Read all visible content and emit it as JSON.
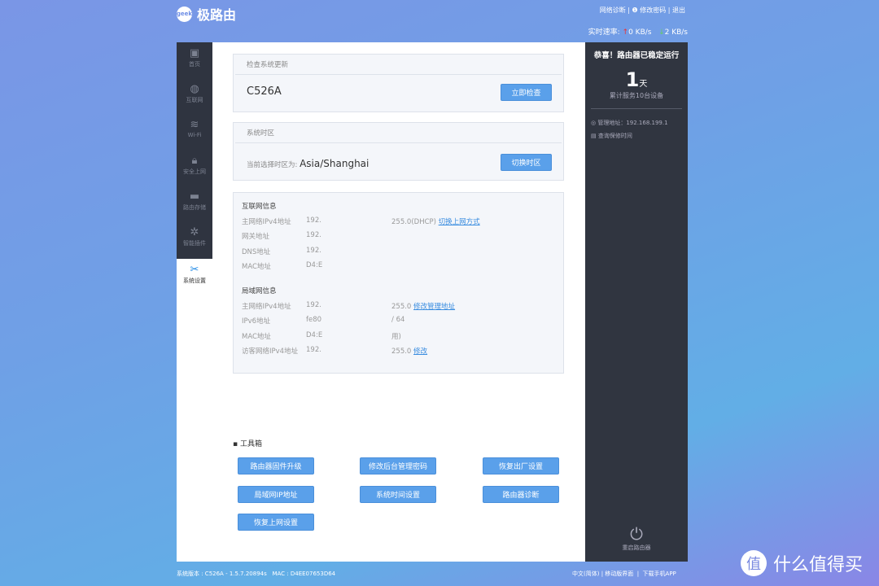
{
  "header": {
    "brand": "极路由",
    "logo_text": "geek",
    "links": [
      "网络诊断",
      "修改密码",
      "退出"
    ],
    "speed_label": "实时速率:",
    "upload": "0 KB/s",
    "download": "2 KB/s"
  },
  "sidebar": {
    "items": [
      {
        "label": "首页",
        "icon": "monitor-icon"
      },
      {
        "label": "互联网",
        "icon": "globe-icon"
      },
      {
        "label": "Wi-Fi",
        "icon": "wifi-icon"
      },
      {
        "label": "安全上网",
        "icon": "lock-icon"
      },
      {
        "label": "路由存储",
        "icon": "folder-icon"
      },
      {
        "label": "智能插件",
        "icon": "plugin-icon"
      },
      {
        "label": "系统设置",
        "icon": "wrench-icon",
        "active": true
      }
    ]
  },
  "update": {
    "title": "检查系统更新",
    "model": "C526A",
    "button": "立即检查"
  },
  "timezone": {
    "title": "系统时区",
    "label": "当前选择时区为:",
    "value": "Asia/Shanghai",
    "button": "切换时区"
  },
  "internet": {
    "title": "互联网信息",
    "rows": [
      {
        "label": "主网络IPv4地址",
        "v1": "192.",
        "v2": "255.0(DHCP)",
        "link": "切换上网方式"
      },
      {
        "label": "网关地址",
        "v1": "192."
      },
      {
        "label": "DNS地址",
        "v1": "192."
      },
      {
        "label": "MAC地址",
        "v1": "D4:E"
      }
    ]
  },
  "lan": {
    "title": "局域网信息",
    "rows": [
      {
        "label": "主网络IPv4地址",
        "v1": "192.",
        "v2": "255.0",
        "link": "修改管理地址"
      },
      {
        "label": "IPv6地址",
        "v1": "fe80",
        "v2": "/ 64"
      },
      {
        "label": "MAC地址",
        "v1": "D4:E",
        "v2": "用)"
      },
      {
        "label": "访客网络IPv4地址",
        "v1": "192.",
        "v2": "255.0",
        "link": "修改"
      }
    ]
  },
  "toolbox": {
    "title": "工具箱",
    "buttons": [
      "路由器固件升级",
      "修改后台管理密码",
      "恢复出厂设置",
      "局域网IP地址",
      "系统时间设置",
      "路由器诊断",
      "恢复上网设置"
    ]
  },
  "status": {
    "headline": "恭喜！路由器已稳定运行",
    "days": "1",
    "days_unit": "天",
    "served": "累计服务10台设备",
    "admin_addr": "管理地址：192.168.199.1",
    "warranty": "查询保修时间",
    "reboot": "重启路由器"
  },
  "footer": {
    "version": "系统版本 : C526A - 1.5.7.20894s",
    "mac": "MAC : D4EE07653D64",
    "lang": "中文(简体)",
    "mobile": "移动版界面",
    "app": "下载手机APP",
    "watermark": "什么值得买"
  }
}
